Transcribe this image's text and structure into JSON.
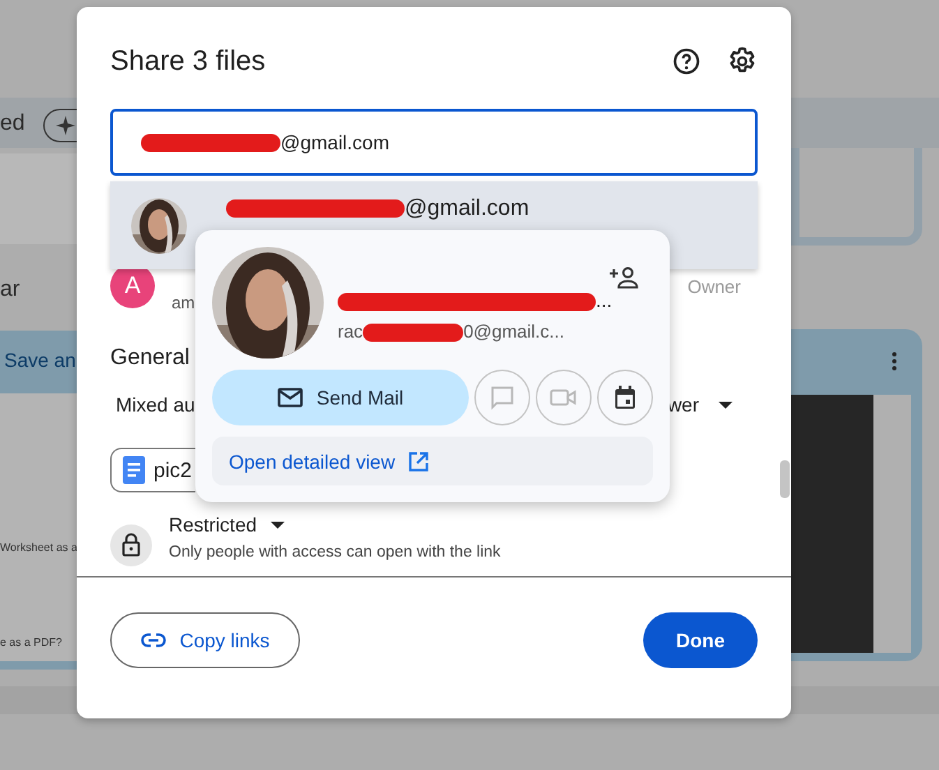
{
  "backdrop": {
    "header_text": "ed",
    "side_label": "ar",
    "card_title": "Save an",
    "doc_lines": [
      "Worksheet as a",
      "e as a PDF?"
    ]
  },
  "dialog": {
    "title": "Share 3 files",
    "recipient_field": {
      "value": "@gmail.com"
    },
    "suggestion": {
      "email": "@gmail.com"
    },
    "people": [
      {
        "initial": "A",
        "color": "#e8437a",
        "email": "am",
        "role": "Owner"
      }
    ],
    "general": {
      "heading": "General",
      "access_left": "Mixed au",
      "access_right": "wer"
    },
    "file_chip": {
      "label": "pic2"
    },
    "link_access": {
      "label": "Restricted",
      "description": "Only people with access can open with the link"
    },
    "buttons": {
      "copy": "Copy links",
      "done": "Done"
    }
  },
  "contact_card": {
    "name": "...",
    "email_start": "rac",
    "email_end": "0@gmail.c...",
    "send_mail": "Send Mail",
    "actions": [
      {
        "kind": "chat",
        "disabled": true
      },
      {
        "kind": "video",
        "disabled": true
      },
      {
        "kind": "calendar",
        "disabled": false
      }
    ],
    "detail_link": "Open detailed view"
  }
}
